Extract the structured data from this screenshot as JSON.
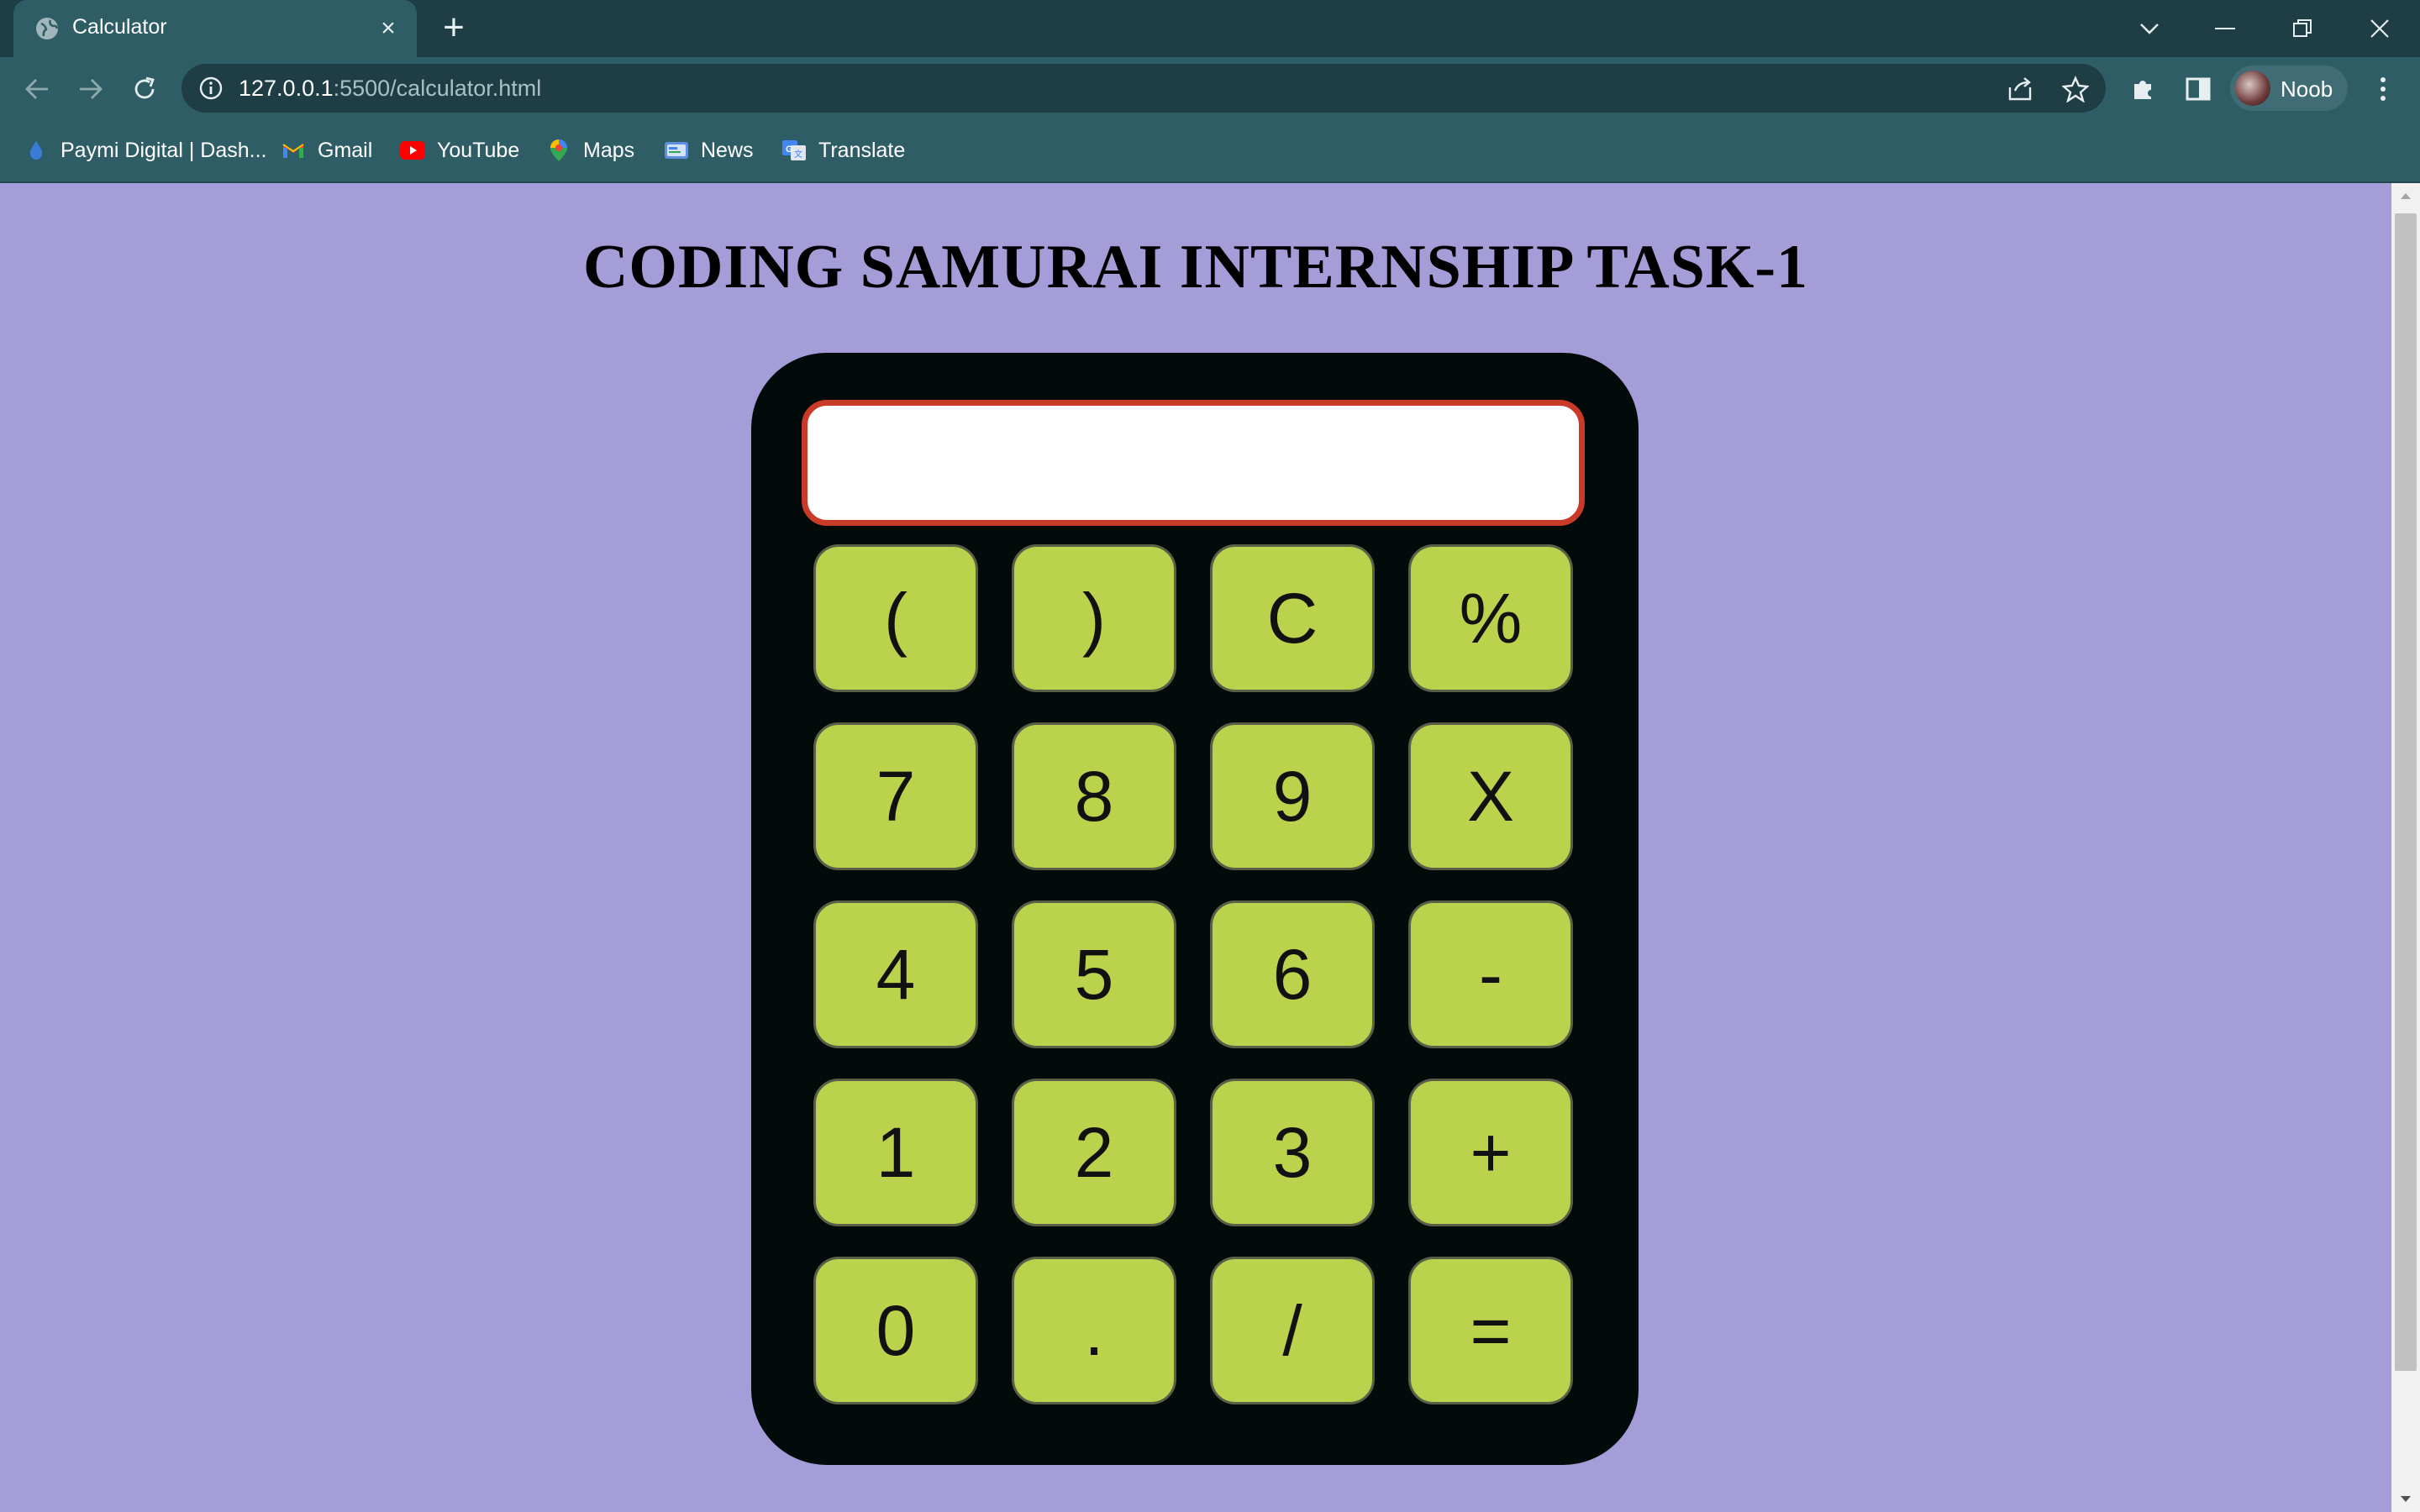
{
  "browser": {
    "tab_title": "Calculator",
    "url_host": "127.0.0.1",
    "url_rest": ":5500/calculator.html",
    "profile_name": "Noob",
    "bookmarks": [
      {
        "label": "Paymi Digital | Dash...",
        "icon": "droplet-icon"
      },
      {
        "label": "Gmail",
        "icon": "gmail-icon"
      },
      {
        "label": "YouTube",
        "icon": "youtube-icon"
      },
      {
        "label": "Maps",
        "icon": "maps-pin-icon"
      },
      {
        "label": "News",
        "icon": "news-icon"
      },
      {
        "label": "Translate",
        "icon": "translate-icon"
      }
    ]
  },
  "page": {
    "title": "CODING SAMURAI INTERNSHIP TASK-1",
    "display_value": "",
    "keys": [
      [
        "(",
        ")",
        "C",
        "%"
      ],
      [
        "7",
        "8",
        "9",
        "X"
      ],
      [
        "4",
        "5",
        "6",
        "-"
      ],
      [
        "1",
        "2",
        "3",
        "+"
      ],
      [
        "0",
        ".",
        "/",
        "="
      ]
    ]
  },
  "colors": {
    "page_background": "#a59dd8",
    "calculator_body": "#030a0a",
    "key_fill": "#bbd24c",
    "display_border": "#c93a29",
    "chrome_dark": "#1e3d45",
    "chrome_light": "#2f5d66"
  }
}
